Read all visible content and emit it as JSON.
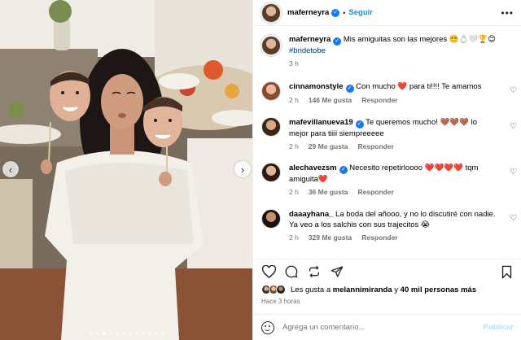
{
  "post": {
    "username": "maferneyra",
    "follow_label": "Seguir",
    "caption_text": "Mis amiguitas son las mejores 😵‍💫💍🤍🏆😊",
    "hashtag": "#bridetobe",
    "caption_age": "3 h"
  },
  "comments": [
    {
      "user": "cinnamonstyle",
      "verified": true,
      "text": "Con mucho ❤️ para ti!!!! Te amamos",
      "age": "2 h",
      "likes": "146 Me gusta",
      "reply": "Responder"
    },
    {
      "user": "mafevillanueva19",
      "verified": true,
      "text": "Te queremos mucho! 🤎🤎🤎 lo mejor para tiiii siempreeeee",
      "age": "2 h",
      "likes": "29 Me gusta",
      "reply": "Responder"
    },
    {
      "user": "alechavezsm",
      "verified": true,
      "text": "Necesito repetirloooo ❤️❤️❤️❤️ tqm amiguita❤️",
      "age": "2 h",
      "likes": "36 Me gusta",
      "reply": "Responder"
    },
    {
      "user": "daaayhana_",
      "verified": false,
      "text": "La boda del añooo, y no lo discutiré con nadie. Ya veo a los salchis con sus trajecitos 😭",
      "age": "2 h",
      "likes": "329 Me gusta",
      "reply": "Responder"
    }
  ],
  "likes_summary": {
    "prefix": "Les gusta a ",
    "user": "melannimiranda",
    "middle": " y ",
    "count": "40 mil personas más"
  },
  "posted_ago": "Hace 3 horas",
  "composer": {
    "placeholder": "Agrega un comentario...",
    "publish_label": "Publicar"
  },
  "icons": [
    "verified-badge-icon",
    "more-options-icon",
    "heart-icon",
    "comment-icon",
    "repost-icon",
    "share-icon",
    "bookmark-icon",
    "emoji-icon",
    "chevron-left-icon",
    "chevron-right-icon"
  ],
  "colors": {
    "link": "#0095f6",
    "verified": "#1877f2",
    "like_red": "#ff3040",
    "hashtag": "#00376b",
    "muted": "#737373"
  }
}
